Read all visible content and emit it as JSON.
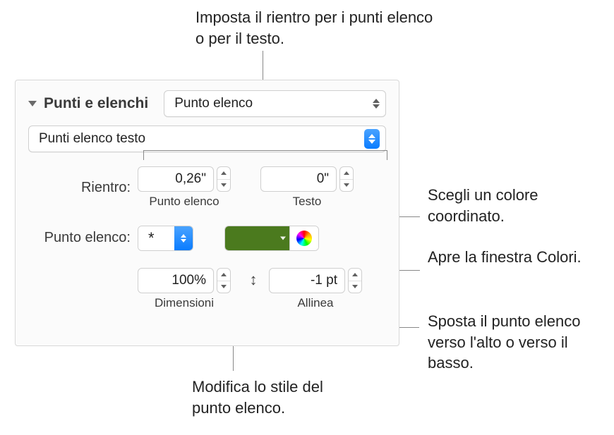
{
  "callouts": {
    "top": "Imposta il rientro per i punti elenco o per il testo.",
    "color_swatch": "Scegli un colore coordinato.",
    "color_wheel": "Apre la finestra Colori.",
    "align": "Sposta il punto elenco verso l'alto o verso il basso.",
    "size": "Modifica lo stile del punto elenco."
  },
  "panel": {
    "section_title": "Punti e elenchi",
    "list_type": "Punto elenco",
    "style_name": "Punti elenco testo",
    "rientro_label": "Rientro:",
    "indent_bullet_value": "0,26\"",
    "indent_bullet_sublabel": "Punto elenco",
    "indent_text_value": "0\"",
    "indent_text_sublabel": "Testo",
    "bullet_label": "Punto elenco:",
    "bullet_char": "*",
    "bullet_color": "#4b7a1e",
    "size_value": "100%",
    "size_sublabel": "Dimensioni",
    "align_value": "-1 pt",
    "align_sublabel": "Allinea"
  }
}
